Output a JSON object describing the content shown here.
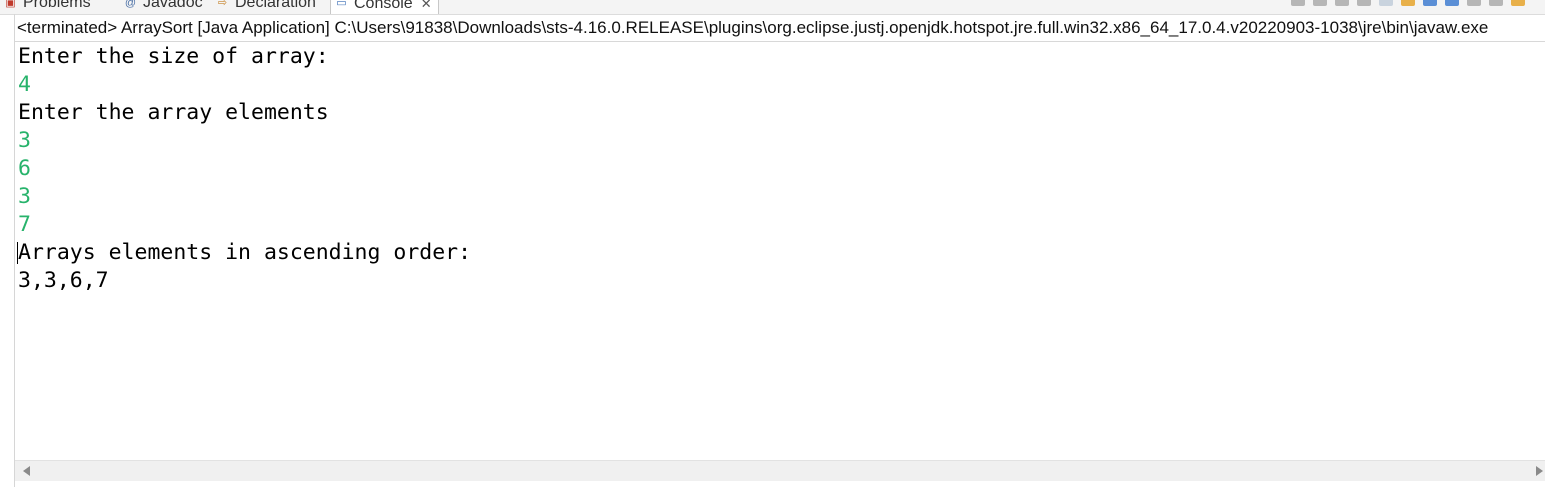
{
  "tabs": [
    {
      "label": "Problems",
      "icon": "problems-icon",
      "icon_glyph": "▣",
      "icon_color": "#c0392b"
    },
    {
      "label": "Javadoc",
      "icon": "javadoc-icon",
      "icon_glyph": "@",
      "icon_color": "#4a6fa5"
    },
    {
      "label": "Declaration",
      "icon": "declaration-icon",
      "icon_glyph": "⇨",
      "icon_color": "#c7862f"
    },
    {
      "label": "Console",
      "icon": "console-icon",
      "icon_glyph": "▭",
      "icon_color": "#3d6fb6",
      "close": "✕"
    }
  ],
  "status_line": "<terminated> ArraySort [Java Application] C:\\Users\\91838\\Downloads\\sts-4.16.0.RELEASE\\plugins\\org.eclipse.justj.openjdk.hotspot.jre.full.win32.x86_64_17.0.4.v20220903-1038\\jre\\bin\\javaw.exe",
  "console": {
    "lines": [
      {
        "text": "Enter the size of array:",
        "kind": "output"
      },
      {
        "text": "4",
        "kind": "input"
      },
      {
        "text": "Enter the array elements",
        "kind": "output"
      },
      {
        "text": "3",
        "kind": "input"
      },
      {
        "text": "6",
        "kind": "input"
      },
      {
        "text": "3",
        "kind": "input"
      },
      {
        "text": "7",
        "kind": "input"
      },
      {
        "text": "Arrays elements in ascending order:",
        "kind": "output"
      },
      {
        "text": "3,3,6,7",
        "kind": "output"
      }
    ],
    "input_color": "#27b36b",
    "output_color": "#000000"
  }
}
